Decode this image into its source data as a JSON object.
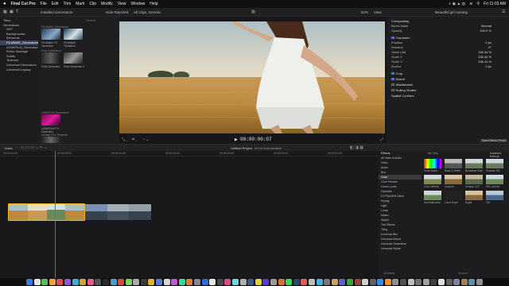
{
  "menubar": {
    "apple": "",
    "items": [
      "Final Cut Pro",
      "File",
      "Edit",
      "Trim",
      "Mark",
      "Clip",
      "Modify",
      "View",
      "Window",
      "Help"
    ],
    "clock": "Fri 11:03 AM"
  },
  "toolbar": {
    "library_popup": "Installed Generators",
    "hide_rejected": "Hide Rejected",
    "viewer_title": "All Clips, Generic",
    "zoom": "52%",
    "view_label": "View",
    "inspector_title": "Beautiful girl running"
  },
  "browser": {
    "sidebar": [
      "Titles",
      "Generators",
      "360°",
      "Backgrounds",
      "Elements",
      "FILMMAK_Generators",
      "LEANFILM_Generators",
      "Photo Montage",
      "Solids",
      "Textures",
      "Universal Generators",
      "Universal Legacy"
    ],
    "search_placeholder": "Search",
    "sections": [
      {
        "title": "FILMMAK_Generators",
        "items": [
          "FILMMAK FX Generator",
          "FILMMAK Transition"
        ]
      },
      {
        "title": "Flow Generators",
        "items": [
          "Flow Generator",
          "Flow Generator 2"
        ]
      },
      {
        "title": "LEANFILM Generators",
        "items": [
          "LEANFILM FX Generator"
        ]
      },
      {
        "title": "Vintage Film Projector",
        "items": [
          "Vintage Projector Effect Generator"
        ]
      }
    ]
  },
  "viewer": {
    "timecode": "00:00:00:07",
    "transform_label": "Transform",
    "crop_label": "Crop",
    "fullscreen": "Full Screen"
  },
  "inspector": {
    "section": "Compositing",
    "rows": [
      {
        "label": "Blend Mode",
        "value": "Normal"
      },
      {
        "label": "Opacity",
        "value": "100.0 %"
      },
      {
        "label": "Transform",
        "value": ""
      },
      {
        "label": "Position",
        "value": "0 px"
      },
      {
        "label": "Rotation",
        "value": "0°"
      },
      {
        "label": "Scale (All)",
        "value": "136.44 %"
      },
      {
        "label": "Scale X",
        "value": "136.44 %"
      },
      {
        "label": "Scale Y",
        "value": "136.44 %"
      },
      {
        "label": "Anchor",
        "value": "0 px"
      },
      {
        "label": "Crop",
        "value": ""
      },
      {
        "label": "Distort",
        "value": ""
      },
      {
        "label": "Stabilization",
        "value": ""
      },
      {
        "label": "Rolling Shutter",
        "value": ""
      },
      {
        "label": "Spatial Conform",
        "value": ""
      }
    ],
    "save_preset": "Save Effects Preset"
  },
  "timeline": {
    "index_label": "Index",
    "project_name": "Untitled Project",
    "duration": "00:14 total duration",
    "ruler": [
      "00:00:00:00",
      "00:00:05:00",
      "00:00:10:00",
      "00:00:15:00",
      "00:00:20:00",
      "00:00:25:00",
      "00:00:30:00"
    ]
  },
  "effects": {
    "title": "Effects",
    "installed": "Installed Effects",
    "categories": [
      "All Video & Audio",
      "Video",
      "Audio",
      "Blur",
      "Color",
      "Color Presets",
      "Comic Looks",
      "Distortion",
      "FCPEASIER Glitch",
      "Keying",
      "Light",
      "Looks",
      "Masks",
      "Stylize",
      "Text Effects",
      "Tiling",
      "Universal Blur",
      "Universal Distort",
      "Universal Generators",
      "Universal Stylize"
    ],
    "selected_category": 4,
    "all_only": "All Only",
    "items": [
      "Color Board",
      "Black & White",
      "Broadcast Safe",
      "Channel EQ",
      "Color Wheels",
      "Colorize",
      "Custom LUT",
      "HSL Curves",
      "Hue/Saturation",
      "Luma Keyer",
      "Sepia",
      "Tint"
    ],
    "count": "12 items",
    "search_placeholder": "Search"
  },
  "colors": {
    "accent": "#4a6fd6",
    "playhead": "#e0432f",
    "clip_selected": "#f0b429",
    "clip_body": "#2b4a7a"
  }
}
